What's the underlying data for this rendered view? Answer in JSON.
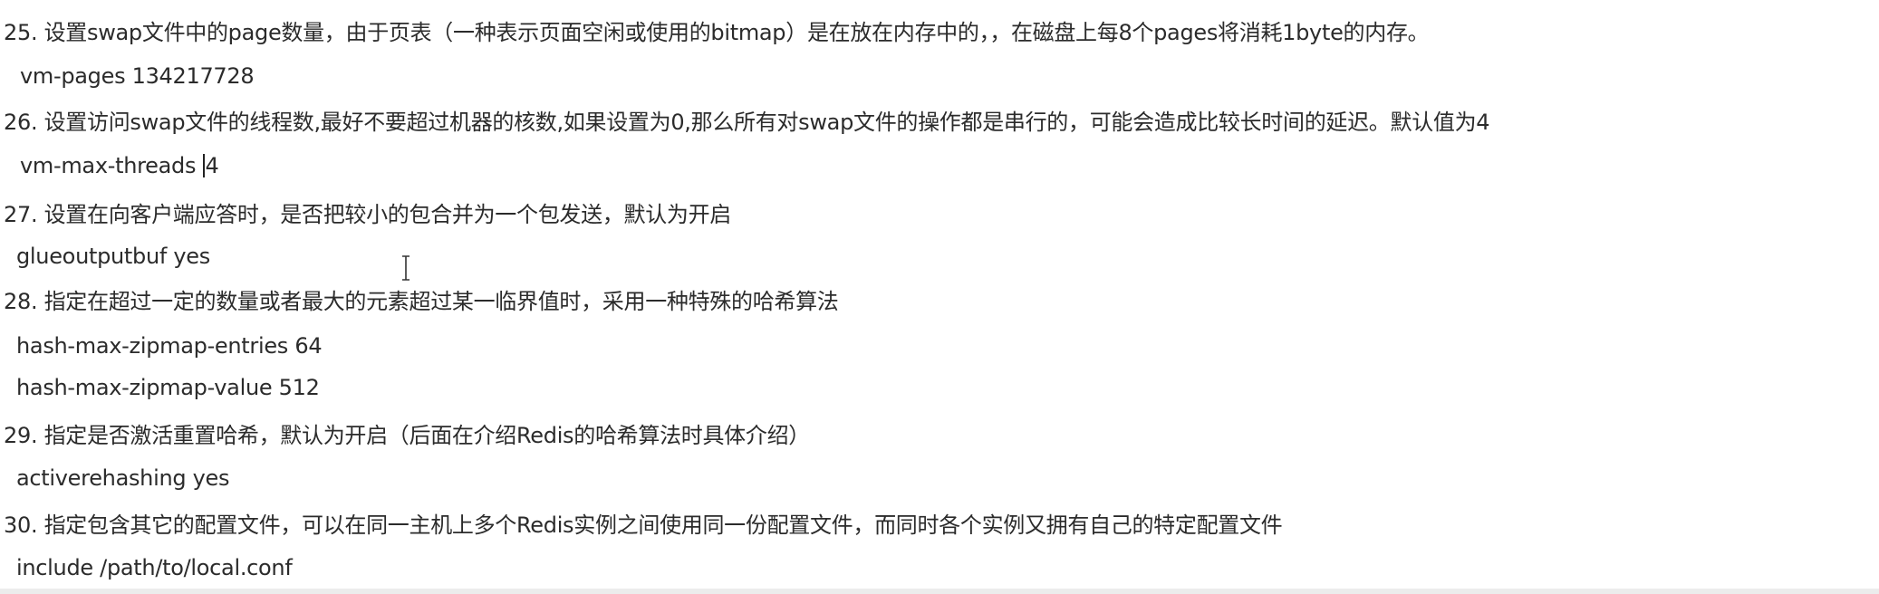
{
  "items": [
    {
      "desc": "25. 设置swap文件中的page数量，由于页表（一种表示页面空闲或使用的bitmap）是在放在内存中的，，在磁盘上每8个pages将消耗1byte的内存。",
      "config": [
        "vm-pages 134217728"
      ]
    },
    {
      "desc": "26. 设置访问swap文件的线程数,最好不要超过机器的核数,如果设置为0,那么所有对swap文件的操作都是串行的，可能会造成比较长时间的延迟。默认值为4",
      "config_prefix": "vm-max-threads ",
      "config_suffix": "4"
    },
    {
      "desc": "27. 设置在向客户端应答时，是否把较小的包合并为一个包发送，默认为开启",
      "config": [
        "glueoutputbuf yes"
      ]
    },
    {
      "desc": "28. 指定在超过一定的数量或者最大的元素超过某一临界值时，采用一种特殊的哈希算法",
      "config": [
        "hash-max-zipmap-entries 64",
        "hash-max-zipmap-value 512"
      ]
    },
    {
      "desc": "29. 指定是否激活重置哈希，默认为开启（后面在介绍Redis的哈希算法时具体介绍）",
      "config": [
        "activerehashing yes"
      ]
    },
    {
      "desc": "30. 指定包含其它的配置文件，可以在同一主机上多个Redis实例之间使用同一份配置文件，而同时各个实例又拥有自己的特定配置文件",
      "config": [
        "include /path/to/local.conf"
      ]
    }
  ]
}
